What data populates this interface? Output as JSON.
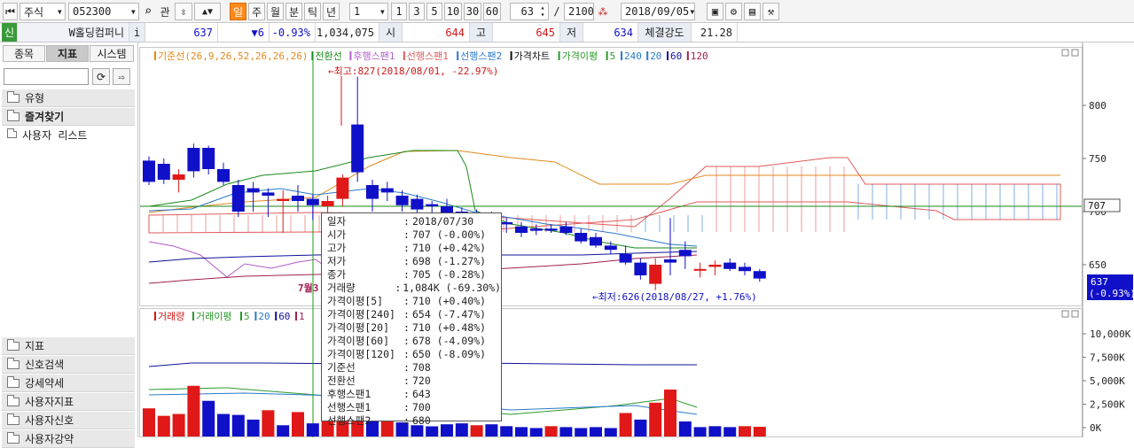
{
  "toolbar": {
    "market": "주식",
    "code": "052300",
    "search_icon": "magnifier-icon",
    "btn_related": "관",
    "btn_day": "일",
    "btn_week": "주",
    "btn_month": "월",
    "btn_minute": "분",
    "btn_tick": "틱",
    "btn_year": "년",
    "period_value": "1",
    "periods": [
      "1",
      "3",
      "5",
      "10",
      "30",
      "60"
    ],
    "count_value": "63",
    "slash": "/",
    "total_value": "2100",
    "date_value": "2018/09/05"
  },
  "quote": {
    "exchange": "신",
    "name": "W홀딩컴퍼니",
    "info": "i",
    "price": "637",
    "change": "▼6",
    "change_pct": "-0.93%",
    "volume": "1,034,075",
    "open_label": "시",
    "open": "644",
    "high_label": "고",
    "high": "645",
    "low_label": "저",
    "low": "634",
    "strength_label": "체결강도",
    "strength": "21.28"
  },
  "sidebar": {
    "tabs": [
      "종목",
      "지표",
      "시스템"
    ],
    "active_tab": "지표",
    "tree": [
      "유형",
      "즐겨찾기",
      "사용자 리스트"
    ],
    "bottom": [
      "지표",
      "신호검색",
      "강세약세",
      "사용자지표",
      "사용자신호",
      "사용자강약"
    ]
  },
  "chart": {
    "legend_ichimoku": [
      {
        "text": "기준선(26,9,26,52,26,26,26)",
        "color": "#e08a1e"
      },
      {
        "text": "전환선",
        "color": "#1a8a1a"
      },
      {
        "text": "후행스팬1",
        "color": "#b05cc8"
      },
      {
        "text": "선행스팬1",
        "color": "#e05a5a"
      },
      {
        "text": "선행스팬2",
        "color": "#2a7ac8"
      },
      {
        "text": "가격차트",
        "color": "#111111"
      },
      {
        "text": "가격이평",
        "color": "#2a9a2a"
      },
      {
        "text": "5",
        "color": "#2a9a2a"
      },
      {
        "text": "240",
        "color": "#2a7ac8"
      },
      {
        "text": "20",
        "color": "#2a7ac8"
      },
      {
        "text": "60",
        "color": "#111199"
      },
      {
        "text": "120",
        "color": "#a02050"
      }
    ],
    "legend_volume": [
      {
        "text": "거래량",
        "color": "#d01818"
      },
      {
        "text": "거래이평",
        "color": "#2a9a2a"
      },
      {
        "text": "5",
        "color": "#2a9a2a"
      },
      {
        "text": "20",
        "color": "#2a7ac8"
      },
      {
        "text": "60",
        "color": "#111199"
      },
      {
        "text": "1",
        "color": "#a02050"
      }
    ],
    "price_axis": [
      "800",
      "750",
      "700",
      "650"
    ],
    "volume_axis": [
      "10,000K",
      "7,500K",
      "5,000K",
      "2,500K",
      "0K"
    ],
    "last_price_tag": "707",
    "current_price": "637",
    "current_pct": "(-0.93%)",
    "max_note": "←최고:827(2018/08/01, -22.97%)",
    "min_note": "←최저:626(2018/08/27, +1.76%)",
    "date_marker": "7월3",
    "tooltip": [
      {
        "k": "일자",
        "v": "2018/07/30"
      },
      {
        "k": "시가",
        "v": "707 (-0.00%)"
      },
      {
        "k": "고가",
        "v": "710 (+0.42%)"
      },
      {
        "k": "저가",
        "v": "698 (-1.27%)"
      },
      {
        "k": "종가",
        "v": "705 (-0.28%)"
      },
      {
        "k": "거래량",
        "v": "1,084K (-69.30%)"
      },
      {
        "k": "가격이평[5]",
        "v": "710 (+0.40%)"
      },
      {
        "k": "가격이평[240]",
        "v": "654 (-7.47%)"
      },
      {
        "k": "가격이평[20]",
        "v": "710 (+0.48%)"
      },
      {
        "k": "가격이평[60]",
        "v": "678 (-4.09%)"
      },
      {
        "k": "가격이평[120]",
        "v": "650 (-8.09%)"
      },
      {
        "k": "기준선",
        "v": "708"
      },
      {
        "k": "전환선",
        "v": "720"
      },
      {
        "k": "후행스팬1",
        "v": "643"
      },
      {
        "k": "선행스팬1",
        "v": "700"
      },
      {
        "k": "선행스팬2",
        "v": "680"
      }
    ]
  },
  "colors": {
    "up": "#e01818",
    "down": "#1010c8",
    "accent": "#2020a0",
    "highlight_day": "#ff8a1a"
  }
}
